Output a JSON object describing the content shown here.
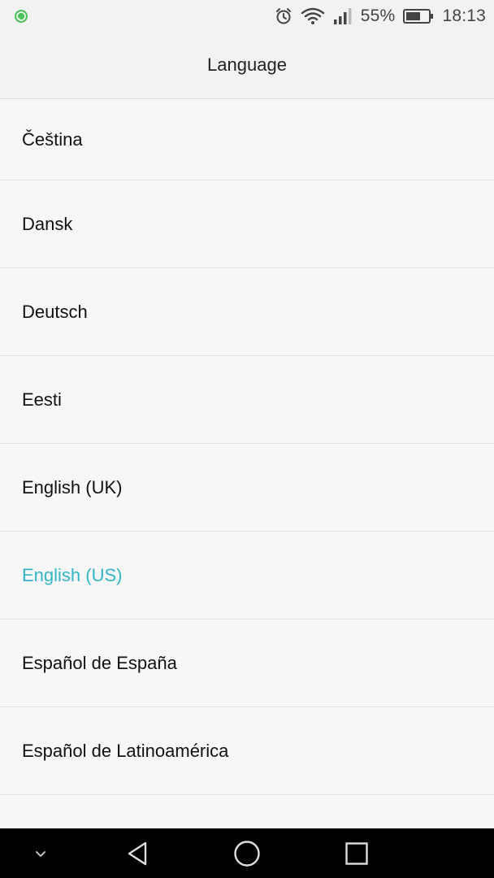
{
  "status_bar": {
    "notification_app": "whatsapp-icon",
    "icons": [
      "alarm-icon",
      "wifi-icon",
      "signal-icon",
      "battery-icon"
    ],
    "battery_percent": "55%",
    "time": "18:13"
  },
  "header": {
    "title": "Language"
  },
  "languages": [
    {
      "label": "Čeština",
      "selected": false
    },
    {
      "label": "Dansk",
      "selected": false
    },
    {
      "label": "Deutsch",
      "selected": false
    },
    {
      "label": "Eesti",
      "selected": false
    },
    {
      "label": "English (UK)",
      "selected": false
    },
    {
      "label": "English (US)",
      "selected": true
    },
    {
      "label": "Español de España",
      "selected": false
    },
    {
      "label": "Español de Latinoamérica",
      "selected": false
    }
  ],
  "colors": {
    "selected_text": "#33b5c8",
    "text": "#111111",
    "nav_bar": "#000000"
  },
  "nav_bar": {
    "buttons": [
      "chevron-down-icon",
      "back-icon",
      "home-icon",
      "recents-icon"
    ]
  }
}
